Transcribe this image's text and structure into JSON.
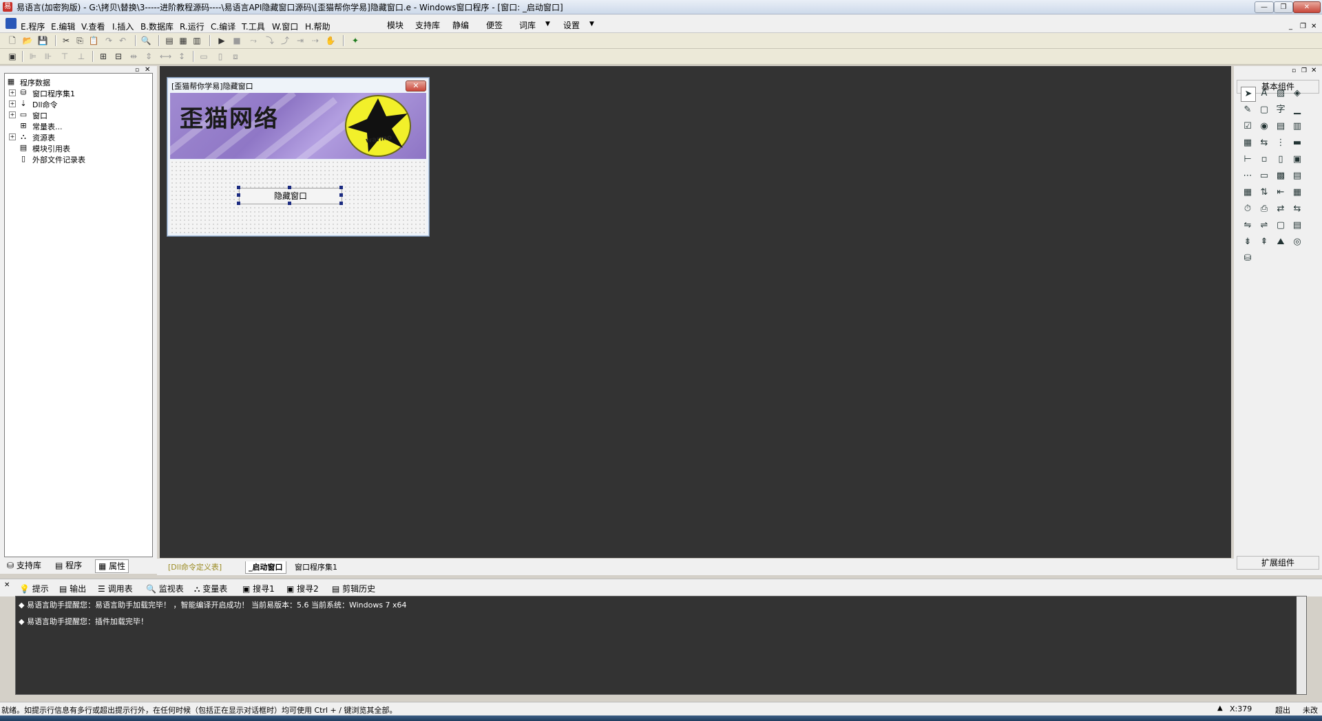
{
  "window": {
    "title": "易语言(加密狗版) - G:\\拷贝\\替换\\3-----进阶教程源码----\\易语言API隐藏窗口源码\\[歪猫帮你学易]隐藏窗口.e - Windows窗口程序 - [窗口: _启动窗口]",
    "minimize": "—",
    "restore": "❐",
    "close": "✕"
  },
  "menu": {
    "items": [
      "E.程序",
      "E.编辑",
      "V.查看",
      "I.插入",
      "B.数据库",
      "R.运行",
      "C.编译",
      "T.工具",
      "W.窗口",
      "H.帮助"
    ],
    "right_items": [
      "模块",
      "支持库",
      "静编",
      "便签",
      "词库",
      "设置"
    ]
  },
  "left_panel": {
    "tree": [
      "程序数据",
      "窗口程序集1",
      "Dll命令",
      "窗口",
      "常量表...",
      "资源表",
      "模块引用表",
      "外部文件记录表"
    ],
    "tabs": [
      "支持库",
      "程序",
      "属性"
    ]
  },
  "designer": {
    "form_title": "[歪猫帮你学易]隐藏窗口",
    "banner_text": "歪猫网络",
    "logo_text": "warmo",
    "button_label": "隐藏窗口",
    "tabs": [
      "[Dll命令定义表]",
      "_启动窗口",
      "窗口程序集1"
    ]
  },
  "right_panel": {
    "header": "基本组件",
    "footer": "扩展组件"
  },
  "output": {
    "tabs": [
      "提示",
      "输出",
      "调用表",
      "监视表",
      "变量表",
      "搜寻1",
      "搜寻2",
      "剪辑历史"
    ],
    "lines": [
      "易语言助手提醒您：易语言助手加载完毕！ ，智能编译开启成功！ 当前易版本：5.6  当前系统：Windows 7 x64",
      "易语言助手提醒您：插件加载完毕！"
    ]
  },
  "status": {
    "text": "就绪。如提示行信息有多行或超出提示行外，在任何时候（包括正在显示对话框时）均可使用 Ctrl + / 键浏览其全部。",
    "coord": "X:379",
    "mode": "超出",
    "state": "未改"
  }
}
